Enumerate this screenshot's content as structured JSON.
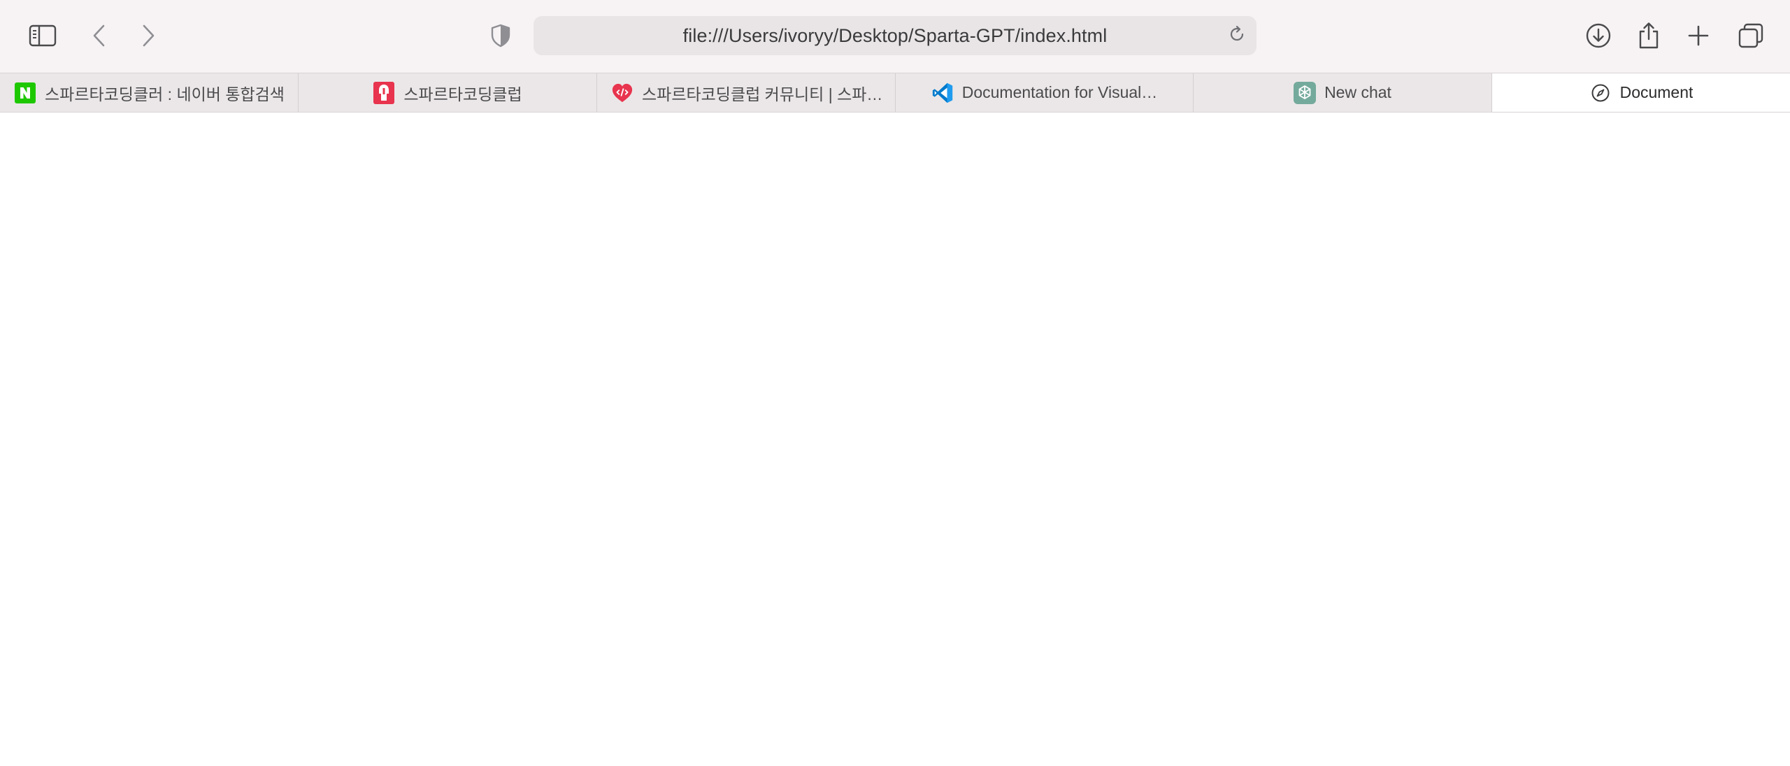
{
  "toolbar": {
    "url": "file:///Users/ivoryy/Desktop/Sparta-GPT/index.html",
    "icons": {
      "sidebar": "sidebar-icon",
      "back": "chevron-left-icon",
      "forward": "chevron-right-icon",
      "privacy": "shield-icon",
      "reload": "reload-icon",
      "download": "download-icon",
      "share": "share-icon",
      "new_tab": "plus-icon",
      "tab_overview": "tabs-overview-icon"
    }
  },
  "tabs": [
    {
      "label": "스파르타코딩클러 : 네이버 통합검색",
      "favicon": "naver-icon",
      "favicon_color": "#1ec800",
      "active": false
    },
    {
      "label": "스파르타코딩클럽",
      "favicon": "sparta-icon",
      "favicon_color": "#e8344e",
      "active": false
    },
    {
      "label": "스파르타코딩클럽 커뮤니티 | 스파…",
      "favicon": "sparta-community-icon",
      "favicon_color": "#e8344e",
      "active": false
    },
    {
      "label": "Documentation for Visual…",
      "favicon": "vscode-icon",
      "favicon_color": "#007acc",
      "active": false
    },
    {
      "label": "New chat",
      "favicon": "chatgpt-icon",
      "favicon_color": "#74aa9c",
      "active": false
    },
    {
      "label": "Document",
      "favicon": "compass-icon",
      "favicon_color": "#3a3a3c",
      "active": true
    }
  ],
  "colors": {
    "toolbar_bg": "#f7f3f4",
    "address_bg": "#e9e5e6",
    "tabbar_bg": "#ebe7e8",
    "active_tab_bg": "#ffffff",
    "content_bg": "#ffffff"
  }
}
